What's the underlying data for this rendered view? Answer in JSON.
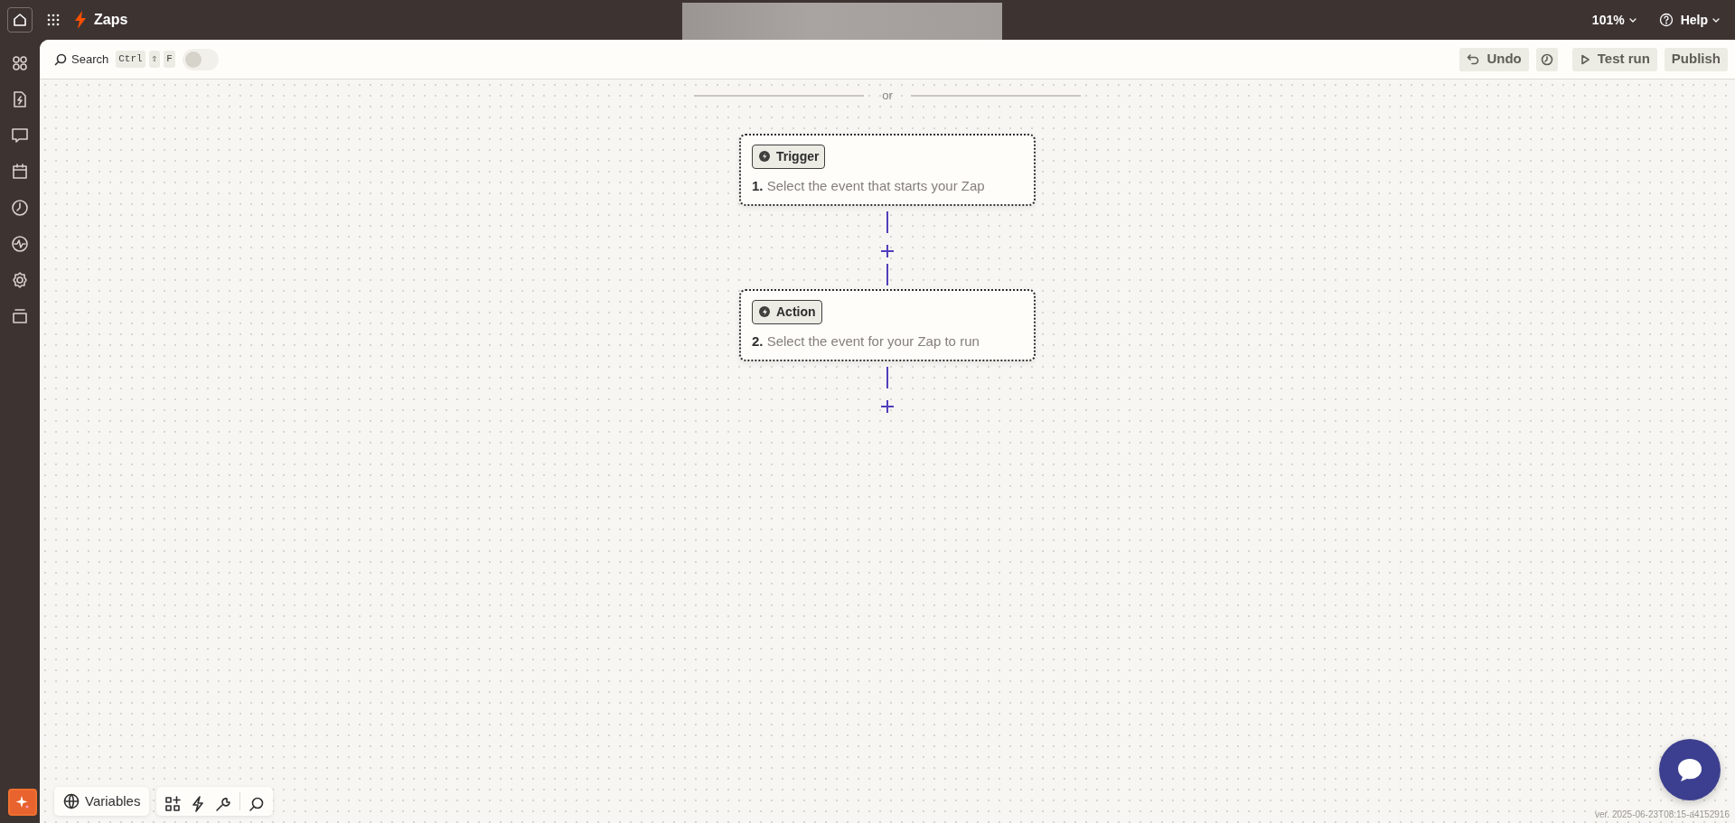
{
  "topbar": {
    "app_title": "Zaps",
    "zoom": "101%",
    "help": "Help"
  },
  "toolbar": {
    "search": "Search",
    "shortcut_keys": [
      "Ctrl",
      "⇧",
      "F"
    ],
    "toggle_on": false,
    "undo": "Undo",
    "test_run": "Test run",
    "publish": "Publish"
  },
  "canvas": {
    "divider_label": "or",
    "steps": [
      {
        "kind": "trigger",
        "badge": "Trigger",
        "number": "1.",
        "text": "Select the event that starts your Zap"
      },
      {
        "kind": "action",
        "badge": "Action",
        "number": "2.",
        "text": "Select the event for your Zap to run"
      }
    ]
  },
  "bottom_toolbar": {
    "variables": "Variables"
  },
  "version": "ver. 2025-06-23T08:15-a4152916"
}
